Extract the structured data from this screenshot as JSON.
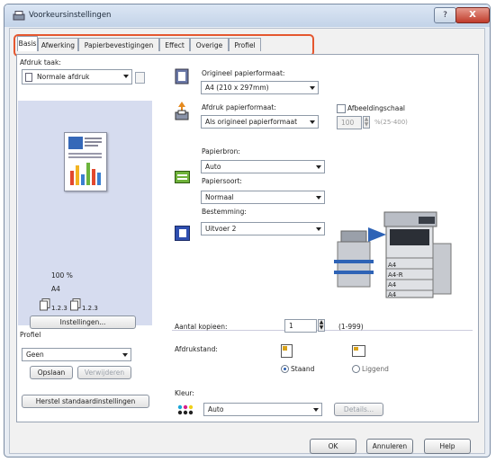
{
  "window": {
    "title": "Voorkeursinstellingen",
    "help": "?",
    "close": "X"
  },
  "tabs": [
    {
      "label": "Basis",
      "active": true
    },
    {
      "label": "Afwerking"
    },
    {
      "label": "Papierbevestigingen"
    },
    {
      "label": "Effect"
    },
    {
      "label": "Overige"
    },
    {
      "label": "Profiel"
    }
  ],
  "left": {
    "print_task_label": "Afdruk taak:",
    "print_task_value": "Normale afdruk",
    "preview_scale": "100 %",
    "preview_paper": "A4",
    "collate_label_1": "1.2.3",
    "collate_label_2": "1.2.3",
    "settings_button": "Instellingen...",
    "profile_label": "Profiel",
    "profile_value": "Geen",
    "save_button": "Opslaan",
    "delete_button": "Verwijderen",
    "restore_button": "Herstel standaardinstellingen"
  },
  "right": {
    "orig_paper_label": "Origineel papierformaat:",
    "orig_paper_value": "A4 (210 x 297mm)",
    "print_paper_label": "Afdruk papierformaat:",
    "print_paper_value": "Als origineel papierformaat",
    "scale_label": "Afbeeldingschaal",
    "scale_value": "100",
    "scale_range": "%(25-400)",
    "paper_source_label": "Papierbron:",
    "paper_source_value": "Auto",
    "paper_type_label": "Papiersoort:",
    "paper_type_value": "Normaal",
    "destination_label": "Bestemming:",
    "destination_value": "Uitvoer 2",
    "tray_labels": [
      "A4",
      "A4-R",
      "A4",
      "A4"
    ],
    "copies_label": "Aantal kopieen:",
    "copies_value": "1",
    "copies_range": "(1-999)",
    "orientation_label": "Afdrukstand:",
    "portrait_label": "Staand",
    "landscape_label": "Liggend",
    "color_label": "Kleur:",
    "color_value": "Auto",
    "details_button": "Details..."
  },
  "footer": {
    "ok": "OK",
    "cancel": "Annuleren",
    "help": "Help"
  },
  "colors": {
    "highlight": "#e5572f",
    "preview_bg": "#d6dcef",
    "close": "#c03b2b"
  }
}
